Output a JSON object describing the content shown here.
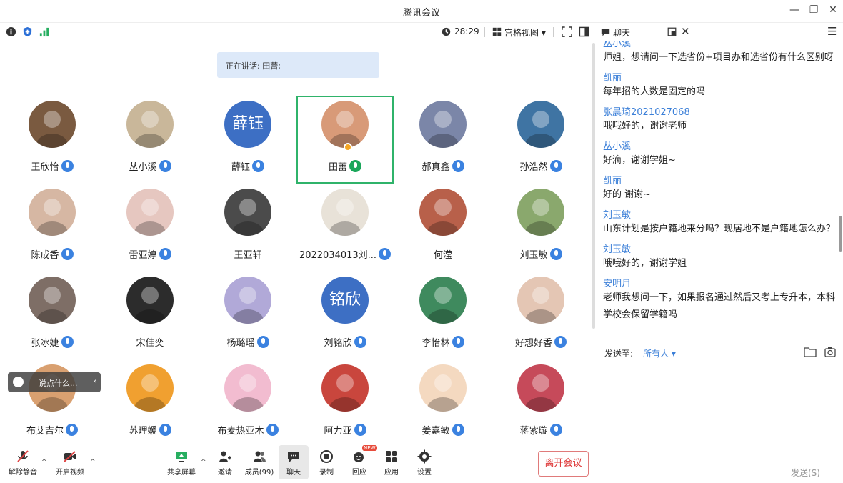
{
  "window": {
    "title": "腾讯会议",
    "minimize": "—",
    "restore": "❐",
    "close": "✕"
  },
  "toolbar": {
    "timer": "28:29",
    "view_mode": "宫格视图 ▾"
  },
  "speaking": "正在讲话: 田蕾;",
  "participants": [
    {
      "name": "王欣怡",
      "mic": true
    },
    {
      "name": "丛小溪",
      "mic": true
    },
    {
      "name": "薛钰",
      "mic": true,
      "avatar_text": "薛钰"
    },
    {
      "name": "田蕾",
      "mic": true,
      "active": true
    },
    {
      "name": "郝真鑫",
      "mic": true
    },
    {
      "name": "孙浩然",
      "mic": true
    },
    {
      "name": "陈成香",
      "mic": true
    },
    {
      "name": "雷亚婷",
      "mic": true
    },
    {
      "name": "王亚轩",
      "mic": false
    },
    {
      "name": "2022034013刘...",
      "mic": true
    },
    {
      "name": "何滢",
      "mic": false
    },
    {
      "name": "刘玉敏",
      "mic": true
    },
    {
      "name": "张冰婕",
      "mic": true
    },
    {
      "name": "宋佳奕",
      "mic": false
    },
    {
      "name": "杨璐瑶",
      "mic": true
    },
    {
      "name": "刘铭欣",
      "mic": true,
      "avatar_text": "铭欣"
    },
    {
      "name": "李怡林",
      "mic": true
    },
    {
      "name": "好想好香",
      "mic": true
    },
    {
      "name": "布艾吉尔",
      "mic": true
    },
    {
      "name": "苏理媛",
      "mic": true
    },
    {
      "name": "布麦热亚木",
      "mic": true
    },
    {
      "name": "阿力亚",
      "mic": true
    },
    {
      "name": "姜嘉敏",
      "mic": true
    },
    {
      "name": "蒋紫璇",
      "mic": true
    }
  ],
  "float_chat": {
    "placeholder": "说点什么..."
  },
  "bottom": {
    "unmute": "解除静音",
    "start_video": "开启视频",
    "share_screen": "共享屏幕",
    "invite": "邀请",
    "members": "成员(99)",
    "chat": "聊天",
    "record": "录制",
    "reactions": "回应",
    "reactions_badge": "NEW",
    "apps": "应用",
    "settings": "设置",
    "leave": "离开会议"
  },
  "chat": {
    "tab_title": "聊天",
    "messages": [
      {
        "name": "丛小溪",
        "text": "师姐，想请问一下选省份+项目办和选省份有什么区别呀"
      },
      {
        "name": "凯丽",
        "text": "每年招的人数是固定的吗"
      },
      {
        "name": "张晨琦2021027068",
        "text": "哦哦好的，谢谢老师"
      },
      {
        "name": "丛小溪",
        "text": "好滴，谢谢学姐~"
      },
      {
        "name": "凯丽",
        "text": "好的 谢谢~"
      },
      {
        "name": "刘玉敏",
        "text": "山东计划是按户籍地来分吗？现居地不是户籍地怎么办？"
      },
      {
        "name": "刘玉敏",
        "text": "哦哦好的，谢谢学姐"
      },
      {
        "name": "安明月",
        "text": "老师我想问一下，如果报名通过然后又考上专升本，本科学校会保留学籍吗"
      }
    ],
    "send_to_label": "发送至:",
    "send_to_value": "所有人 ▾",
    "send_button": "发送(S)"
  }
}
